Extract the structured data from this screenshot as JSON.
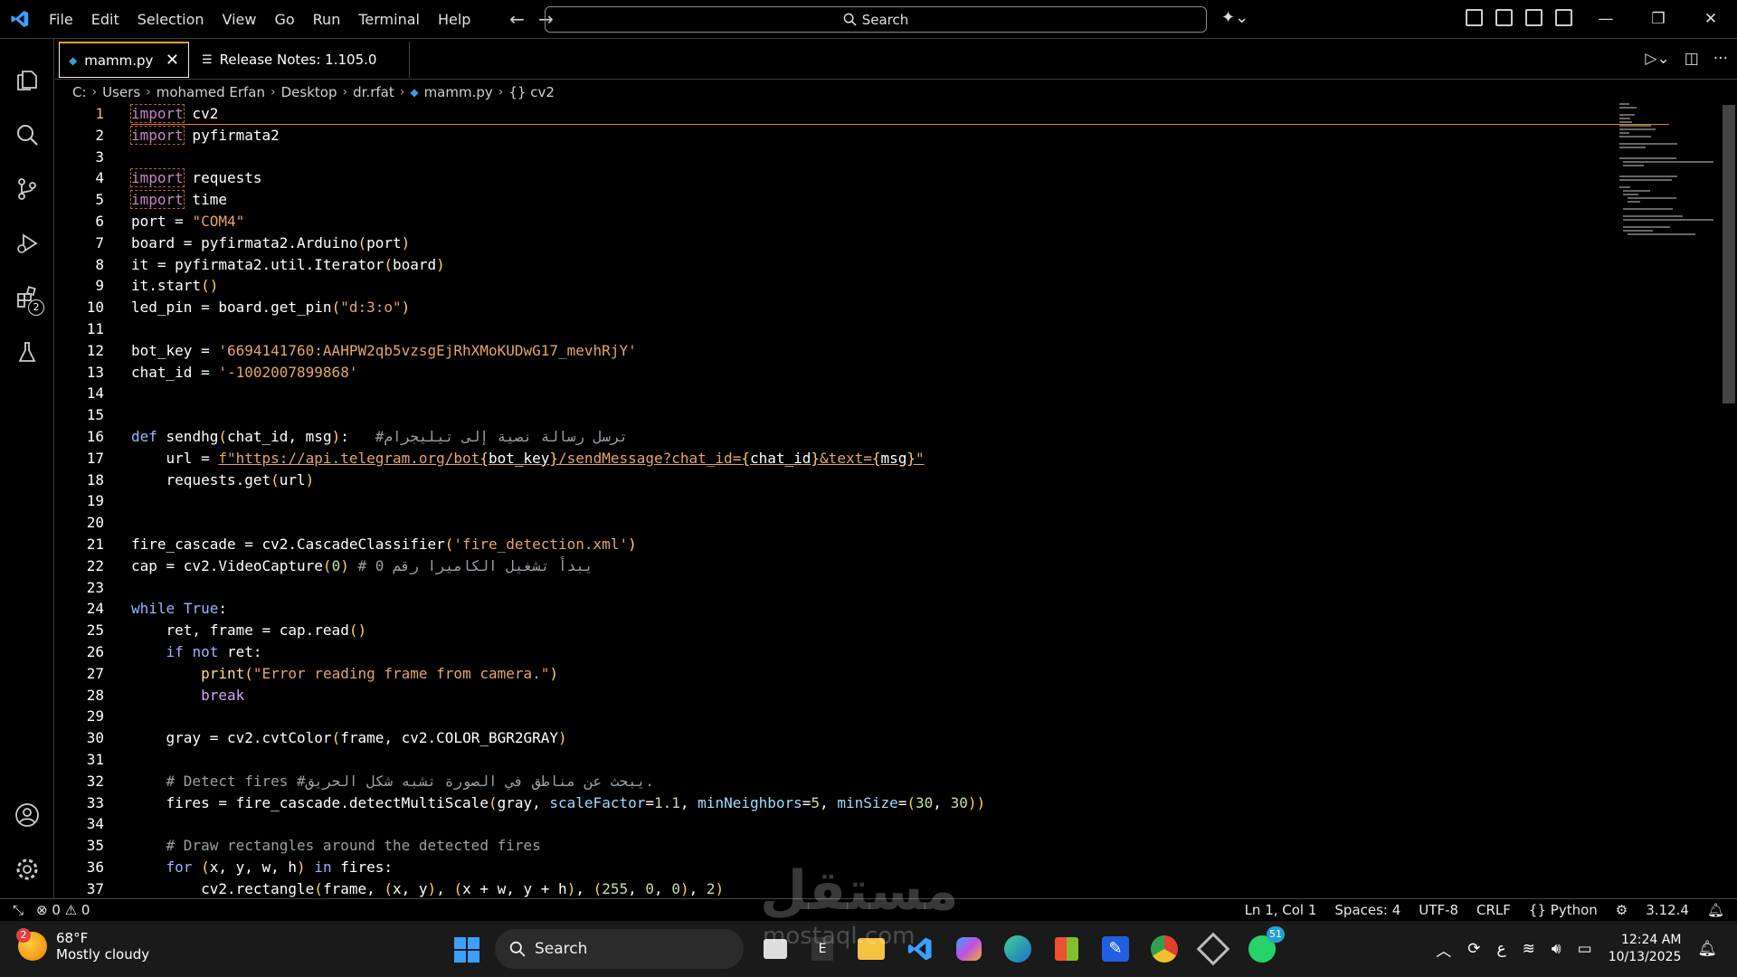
{
  "menu": [
    "File",
    "Edit",
    "Selection",
    "View",
    "Go",
    "Run",
    "Terminal",
    "Help"
  ],
  "search": {
    "label": "Search"
  },
  "tabs": [
    {
      "label": "mamm.py"
    },
    {
      "label": "Release Notes: 1.105.0"
    }
  ],
  "breadcrumb": [
    "C:",
    "Users",
    "mohamed Erfan",
    "Desktop",
    "dr.rfat",
    "mamm.py",
    "{} cv2"
  ],
  "activity_badge": "2",
  "status": {
    "errors": "0",
    "warnings": "0",
    "position": "Ln 1, Col 1",
    "spaces": "Spaces: 4",
    "encoding": "UTF-8",
    "eol": "CRLF",
    "language": "{} Python",
    "python_version": "3.12.4"
  },
  "taskbar": {
    "temperature": "68°F",
    "weather": "Mostly cloudy",
    "weather_badge": "2",
    "search": "Search",
    "whatsapp_badge": "51",
    "time": "12:24 AM",
    "date": "10/13/2025",
    "keyboard": "ع"
  },
  "watermark": {
    "main": "مستقل",
    "sub": "mostaql.com"
  },
  "code_lines": [
    "import cv2",
    "import pyfirmata2",
    "",
    "import requests",
    "import time",
    "port = \"COM4\"",
    "board = pyfirmata2.Arduino(port)",
    "it = pyfirmata2.util.Iterator(board)",
    "it.start()",
    "led_pin = board.get_pin(\"d:3:o\")",
    "",
    "bot_key = '6694141760:AAHPW2qb5vzsgEjRhXMoKUDwG17_mevhRjY'",
    "chat_id = '-1002007899868'",
    "",
    "",
    "def sendhg(chat_id, msg):   #ترسل رسالة نصية إلى تيليجرام",
    "    url = f\"https://api.telegram.org/bot{bot_key}/sendMessage?chat_id={chat_id}&text={msg}\"",
    "    requests.get(url)",
    "",
    "",
    "fire_cascade = cv2.CascadeClassifier('fire_detection.xml')",
    "cap = cv2.VideoCapture(0) # يبدأ تشغيل الكاميرا رقم 0",
    "",
    "while True:",
    "    ret, frame = cap.read()",
    "    if not ret:",
    "        print(\"Error reading frame from camera.\")",
    "        break",
    "",
    "    gray = cv2.cvtColor(frame, cv2.COLOR_BGR2GRAY)",
    "",
    "    # Detect fires #يبحث عن مناطق في الصورة تشبه شكل الحريق.",
    "    fires = fire_cascade.detectMultiScale(gray, scaleFactor=1.1, minNeighbors=5, minSize=(30, 30))",
    "",
    "    # Draw rectangles around the detected fires",
    "    for (x, y, w, h) in fires:",
    "        cv2.rectangle(frame, (x, y), (x + w, y + h), (255, 0, 0), 2)"
  ]
}
